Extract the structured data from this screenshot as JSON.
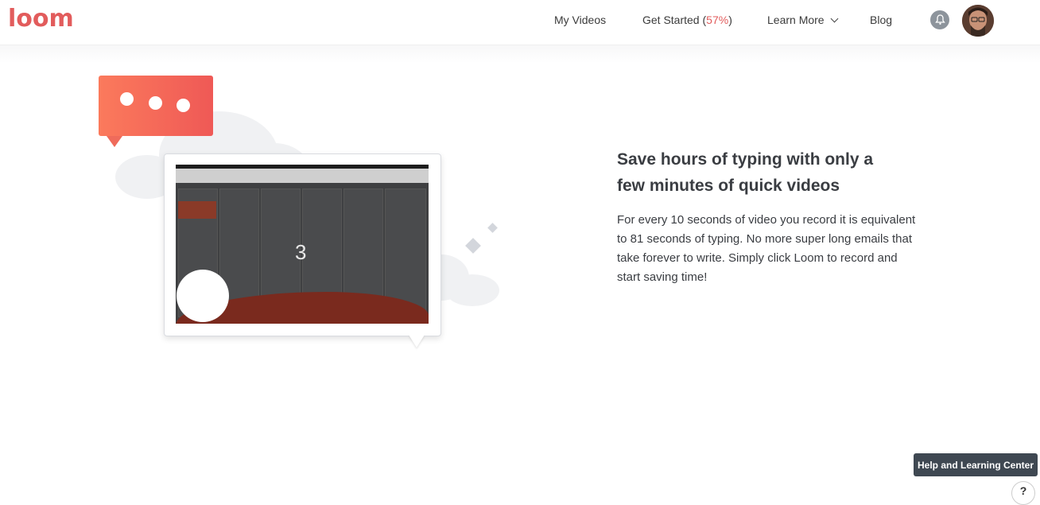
{
  "header": {
    "logo_text": "loom",
    "nav": {
      "my_videos": "My Videos",
      "get_started": "Get Started",
      "get_started_pct_open": "(",
      "get_started_pct": "57%",
      "get_started_pct_close": ")",
      "learn_more": "Learn More",
      "blog": "Blog"
    }
  },
  "illustration": {
    "countdown": "3"
  },
  "main": {
    "headline_line1": "Save hours of typing with only a",
    "headline_line2": "few minutes of quick videos",
    "body_line1": "For every 10 seconds of video you record it is equivalent",
    "body_line2": "to 81 seconds of typing. No more super long emails that",
    "body_line3": "take forever to write. Simply click Loom to record and",
    "body_line4": "start saving time!"
  },
  "help": {
    "label": "Help and Learning Center",
    "icon_glyph": "?"
  },
  "colors": {
    "brand": "#e25c5c",
    "bubble": "#f26a58",
    "help_bg": "#3f4852"
  }
}
